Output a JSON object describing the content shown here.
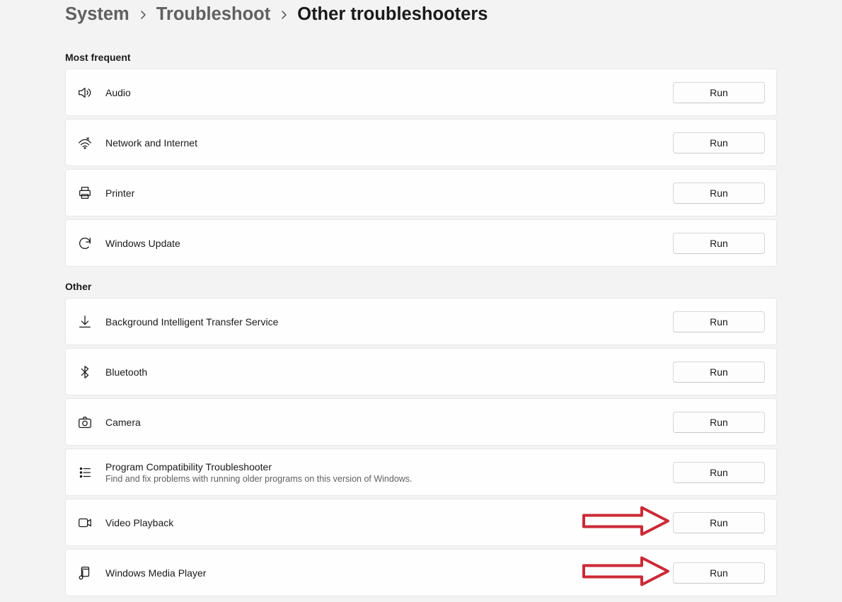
{
  "breadcrumb": {
    "root": "System",
    "parent": "Troubleshoot",
    "current": "Other troubleshooters"
  },
  "sections": {
    "mostFrequent": {
      "header": "Most frequent",
      "items": [
        {
          "icon": "audio-icon",
          "title": "Audio",
          "button": "Run"
        },
        {
          "icon": "network-icon",
          "title": "Network and Internet",
          "button": "Run"
        },
        {
          "icon": "printer-icon",
          "title": "Printer",
          "button": "Run"
        },
        {
          "icon": "update-icon",
          "title": "Windows Update",
          "button": "Run"
        }
      ]
    },
    "other": {
      "header": "Other",
      "items": [
        {
          "icon": "download-icon",
          "title": "Background Intelligent Transfer Service",
          "button": "Run"
        },
        {
          "icon": "bluetooth-icon",
          "title": "Bluetooth",
          "button": "Run"
        },
        {
          "icon": "camera-icon",
          "title": "Camera",
          "button": "Run"
        },
        {
          "icon": "compat-icon",
          "title": "Program Compatibility Troubleshooter",
          "desc": "Find and fix problems with running older programs on this version of Windows.",
          "button": "Run"
        },
        {
          "icon": "video-icon",
          "title": "Video Playback",
          "button": "Run",
          "arrow": true
        },
        {
          "icon": "media-icon",
          "title": "Windows Media Player",
          "button": "Run",
          "arrow": true
        }
      ]
    }
  }
}
